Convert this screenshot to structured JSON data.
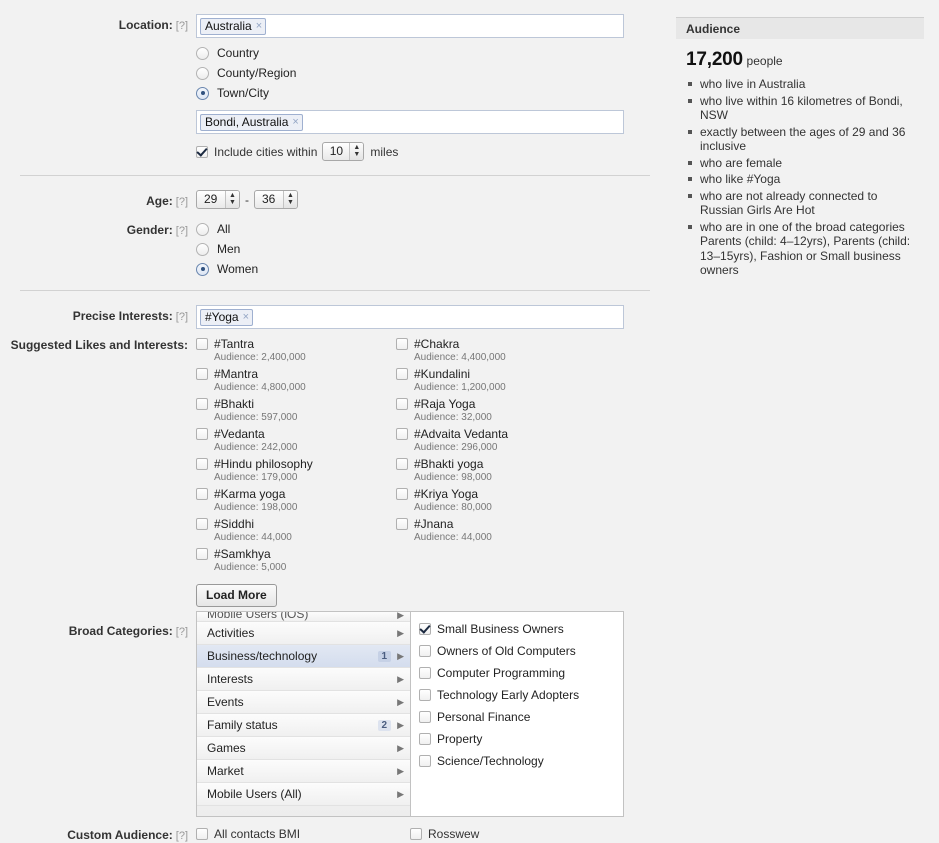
{
  "form": {
    "location": {
      "label": "Location:",
      "help": "[?]",
      "country_token": "Australia",
      "token_x": "×",
      "scope_options": [
        {
          "label": "Country",
          "selected": false
        },
        {
          "label": "County/Region",
          "selected": false
        },
        {
          "label": "Town/City",
          "selected": true
        }
      ],
      "city_token": "Bondi, Australia",
      "include_label": "Include cities within",
      "include_checked": true,
      "radius_value": "10",
      "radius_unit": "miles"
    },
    "age": {
      "label": "Age:",
      "help": "[?]",
      "min": "29",
      "dash": "-",
      "max": "36"
    },
    "gender": {
      "label": "Gender:",
      "help": "[?]",
      "options": [
        {
          "label": "All",
          "selected": false
        },
        {
          "label": "Men",
          "selected": false
        },
        {
          "label": "Women",
          "selected": true
        }
      ]
    },
    "precise_interests": {
      "label": "Precise Interests:",
      "help": "[?]",
      "token": "#Yoga"
    },
    "suggested": {
      "label": "Suggested Likes and Interests:",
      "left_column": [
        {
          "name": "#Tantra",
          "audience": "Audience: 2,400,000",
          "checked": false
        },
        {
          "name": "#Mantra",
          "audience": "Audience: 4,800,000",
          "checked": false
        },
        {
          "name": "#Bhakti",
          "audience": "Audience: 597,000",
          "checked": false
        },
        {
          "name": "#Vedanta",
          "audience": "Audience: 242,000",
          "checked": false
        },
        {
          "name": "#Hindu philosophy",
          "audience": "Audience: 179,000",
          "checked": false
        },
        {
          "name": "#Karma yoga",
          "audience": "Audience: 198,000",
          "checked": false
        },
        {
          "name": "#Siddhi",
          "audience": "Audience: 44,000",
          "checked": false
        },
        {
          "name": "#Samkhya",
          "audience": "Audience: 5,000",
          "checked": false
        }
      ],
      "right_column": [
        {
          "name": "#Chakra",
          "audience": "Audience: 4,400,000",
          "checked": false
        },
        {
          "name": "#Kundalini",
          "audience": "Audience: 1,200,000",
          "checked": false
        },
        {
          "name": "#Raja Yoga",
          "audience": "Audience: 32,000",
          "checked": false
        },
        {
          "name": "#Advaita Vedanta",
          "audience": "Audience: 296,000",
          "checked": false
        },
        {
          "name": "#Bhakti yoga",
          "audience": "Audience: 98,000",
          "checked": false
        },
        {
          "name": "#Kriya Yoga",
          "audience": "Audience: 80,000",
          "checked": false
        },
        {
          "name": "#Jnana",
          "audience": "Audience: 44,000",
          "checked": false
        }
      ],
      "load_more": "Load More"
    },
    "broad_categories": {
      "label": "Broad Categories:",
      "help": "[?]",
      "categories": [
        {
          "name": "Mobile Users (iOS)",
          "count": "",
          "selected": false,
          "partial": true
        },
        {
          "name": "Activities",
          "count": "",
          "selected": false,
          "partial": false
        },
        {
          "name": "Business/technology",
          "count": "1",
          "selected": true,
          "partial": false
        },
        {
          "name": "Interests",
          "count": "",
          "selected": false,
          "partial": false
        },
        {
          "name": "Events",
          "count": "",
          "selected": false,
          "partial": false
        },
        {
          "name": "Family status",
          "count": "2",
          "selected": false,
          "partial": false
        },
        {
          "name": "Games",
          "count": "",
          "selected": false,
          "partial": false
        },
        {
          "name": "Market",
          "count": "",
          "selected": false,
          "partial": false
        },
        {
          "name": "Mobile Users (All)",
          "count": "",
          "selected": false,
          "partial": false
        }
      ],
      "arrow": "▶",
      "options": [
        {
          "label": "Small Business Owners",
          "checked": true
        },
        {
          "label": "Owners of Old Computers",
          "checked": false
        },
        {
          "label": "Computer Programming",
          "checked": false
        },
        {
          "label": "Technology Early Adopters",
          "checked": false
        },
        {
          "label": "Personal Finance",
          "checked": false
        },
        {
          "label": "Property",
          "checked": false
        },
        {
          "label": "Science/Technology",
          "checked": false
        }
      ]
    },
    "custom_audience": {
      "label": "Custom Audience:",
      "help": "[?]",
      "option_left": "All contacts BMI",
      "option_right": "Rosswew"
    }
  },
  "audience": {
    "title": "Audience",
    "count": "17,200",
    "count_unit": "people",
    "criteria": [
      "who live in Australia",
      "who live within 16 kilometres of Bondi, NSW",
      "exactly between the ages of 29 and 36 inclusive",
      "who are female",
      "who like #Yoga",
      "who are not already connected to Russian Girls Are Hot",
      "who are in one of the broad categories Parents (child: 4–12yrs), Parents (child: 13–15yrs), Fashion or Small business owners"
    ]
  }
}
